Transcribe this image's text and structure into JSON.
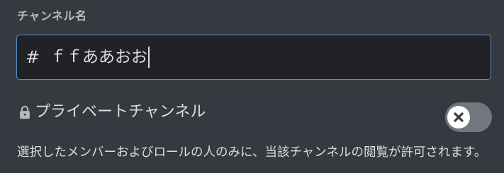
{
  "section": {
    "label": "チャンネル名"
  },
  "channel_input": {
    "value": "ｆｆああおお",
    "icon": "hash-icon"
  },
  "private_channel": {
    "label": "プライベートチャンネル",
    "icon": "lock-icon",
    "enabled": false,
    "description": "選択したメンバーおよびロールの人のみに、当該チャンネルの閲覧が許可されます。"
  },
  "colors": {
    "background": "#36393f",
    "input_background": "#202225",
    "input_border_focus": "#5b8ecb",
    "text": "#dcddde",
    "label": "#b9bbbe",
    "toggle_off": "#72767d"
  }
}
